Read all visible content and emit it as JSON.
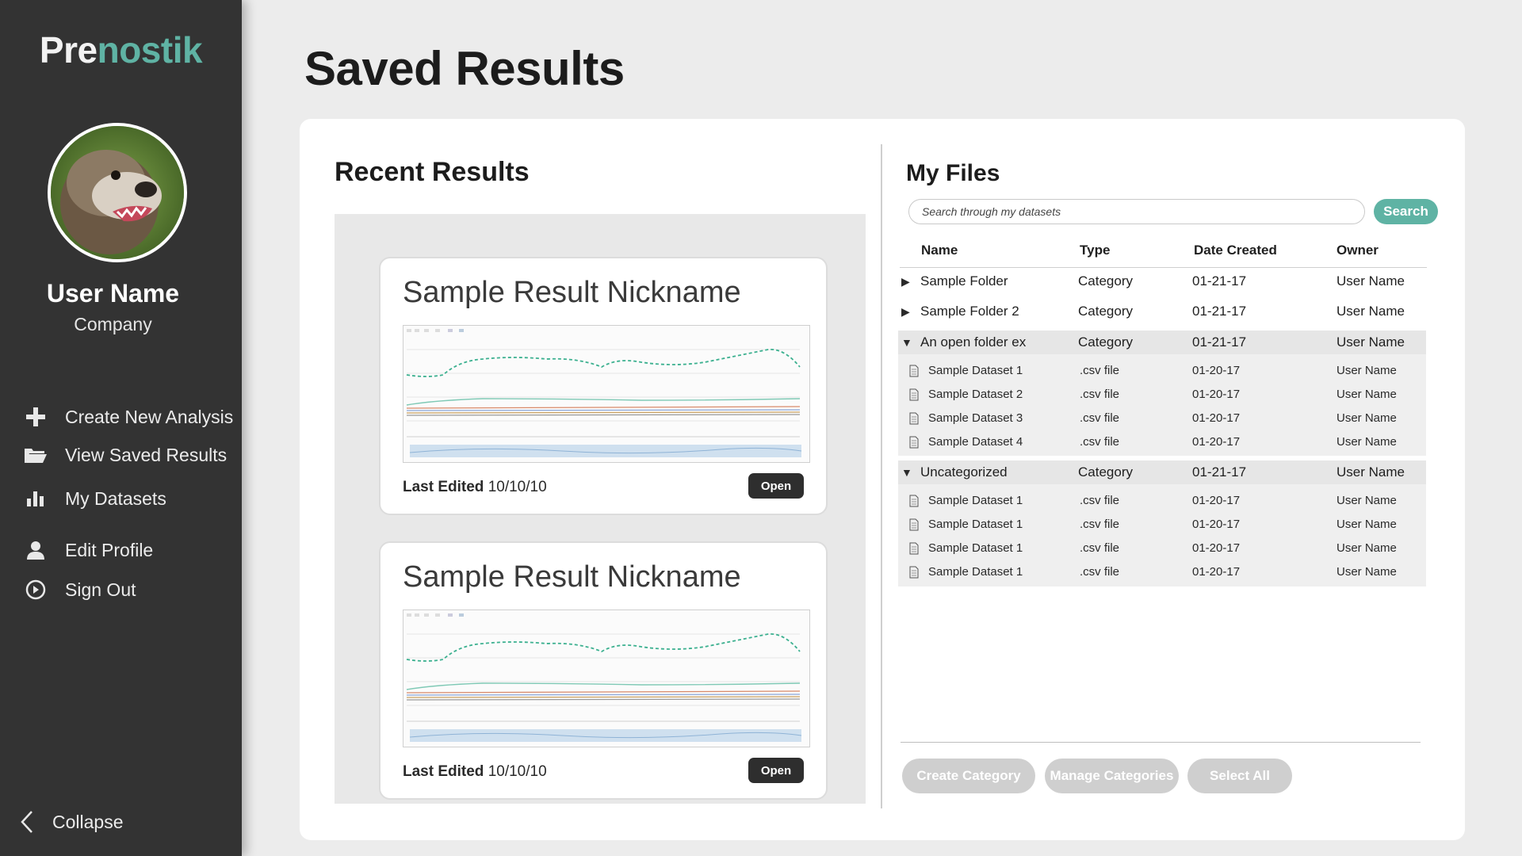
{
  "brand": {
    "logo_part1": "Pre",
    "logo_part2": "nostik",
    "accent": "#5fb3a4"
  },
  "user": {
    "name": "User Name",
    "company": "Company"
  },
  "nav": [
    {
      "label": "Create New Analysis",
      "icon": "plus-icon"
    },
    {
      "label": "View Saved Results",
      "icon": "folder-open-icon"
    },
    {
      "label": "My Datasets",
      "icon": "bar-chart-icon"
    },
    {
      "label": "Edit Profile",
      "icon": "user-icon"
    },
    {
      "label": "Sign Out",
      "icon": "power-icon"
    }
  ],
  "collapse_label": "Collapse",
  "page_title": "Saved Results",
  "recent": {
    "title": "Recent Results",
    "cards": [
      {
        "nickname": "Sample Result Nickname",
        "edited_label": "Last Edited",
        "edited_date": "10/10/10",
        "open_label": "Open"
      },
      {
        "nickname": "Sample Result Nickname",
        "edited_label": "Last Edited",
        "edited_date": "10/10/10",
        "open_label": "Open"
      }
    ]
  },
  "files": {
    "title": "My Files",
    "search_placeholder": "Search through my datasets",
    "search_label": "Search",
    "columns": [
      "Name",
      "Type",
      "Date Created",
      "Owner"
    ],
    "folders": [
      {
        "name": "Sample Folder",
        "type": "Category",
        "date": "01-21-17",
        "owner": "User Name",
        "open": false
      },
      {
        "name": "Sample Folder 2",
        "type": "Category",
        "date": "01-21-17",
        "owner": "User Name",
        "open": false
      },
      {
        "name": "An open folder ex",
        "type": "Category",
        "date": "01-21-17",
        "owner": "User Name",
        "open": true,
        "files": [
          {
            "name": "Sample Dataset 1",
            "type": ".csv file",
            "date": "01-20-17",
            "owner": "User Name"
          },
          {
            "name": "Sample Dataset 2",
            "type": ".csv file",
            "date": "01-20-17",
            "owner": "User Name"
          },
          {
            "name": "Sample Dataset 3",
            "type": ".csv file",
            "date": "01-20-17",
            "owner": "User Name"
          },
          {
            "name": "Sample Dataset 4",
            "type": ".csv file",
            "date": "01-20-17",
            "owner": "User Name"
          }
        ]
      },
      {
        "name": "Uncategorized",
        "type": "Category",
        "date": "01-21-17",
        "owner": "User Name",
        "open": true,
        "files": [
          {
            "name": "Sample Dataset 1",
            "type": ".csv file",
            "date": "01-20-17",
            "owner": "User Name"
          },
          {
            "name": "Sample Dataset 1",
            "type": ".csv file",
            "date": "01-20-17",
            "owner": "User Name"
          },
          {
            "name": "Sample Dataset 1",
            "type": ".csv file",
            "date": "01-20-17",
            "owner": "User Name"
          },
          {
            "name": "Sample Dataset 1",
            "type": ".csv file",
            "date": "01-20-17",
            "owner": "User Name"
          }
        ]
      }
    ],
    "actions": [
      "Create Category",
      "Manage Categories",
      "Select All"
    ]
  }
}
